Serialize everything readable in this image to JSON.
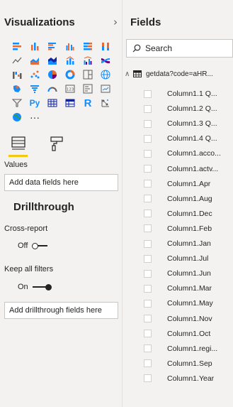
{
  "visualizations": {
    "title": "Visualizations",
    "collapse_icon": "chevron-right-icon",
    "icons": [
      "stacked-bar-chart-icon",
      "stacked-column-chart-icon",
      "clustered-bar-chart-icon",
      "clustered-column-chart-icon",
      "100-stacked-bar-chart-icon",
      "100-stacked-column-chart-icon",
      "line-chart-icon",
      "area-chart-icon",
      "stacked-area-chart-icon",
      "line-and-column-chart-icon",
      "line-and-clustered-column-chart-icon",
      "ribbon-chart-icon",
      "waterfall-chart-icon",
      "scatter-chart-icon",
      "pie-chart-icon",
      "donut-chart-icon",
      "treemap-icon",
      "map-icon",
      "filled-map-icon",
      "funnel-icon",
      "gauge-icon",
      "card-icon",
      "multi-row-card-icon",
      "kpi-icon",
      "slicer-icon",
      "python-visual-icon",
      "table-icon",
      "matrix-icon",
      "r-visual-icon",
      "key-influencers-icon",
      "arcgis-map-icon",
      "more-visuals-icon"
    ],
    "python_label": "Py",
    "r_label": "R",
    "more_label": "···",
    "fields_tab_icon": "fields-tab-icon",
    "format_tab_icon": "paint-roller-icon",
    "values_label": "Values",
    "values_placeholder": "Add data fields here",
    "drillthrough_title": "Drillthrough",
    "cross_report_label": "Cross-report",
    "cross_report_state": "Off",
    "keep_filters_label": "Keep all filters",
    "keep_filters_state": "On",
    "drillthrough_placeholder": "Add drillthrough fields here"
  },
  "fields": {
    "title": "Fields",
    "collapse_icon": "chevron-right-icon",
    "search_placeholder": "Search",
    "table_name": "getdata?code=aHR...",
    "items": [
      "Column1.1 Q...",
      "Column1.2 Q...",
      "Column1.3 Q...",
      "Column1.4 Q...",
      "Column1.acco...",
      "Column1.actv...",
      "Column1.Apr",
      "Column1.Aug",
      "Column1.Dec",
      "Column1.Feb",
      "Column1.Jan",
      "Column1.Jul",
      "Column1.Jun",
      "Column1.Mar",
      "Column1.May",
      "Column1.Nov",
      "Column1.Oct",
      "Column1.regi...",
      "Column1.Sep",
      "Column1.Year"
    ]
  },
  "colors": {
    "accent_yellow": "#f2c811",
    "viz_orange": "#e66c37",
    "viz_blue": "#118dff",
    "viz_purple": "#6b007b",
    "viz_teal": "#12239e"
  }
}
